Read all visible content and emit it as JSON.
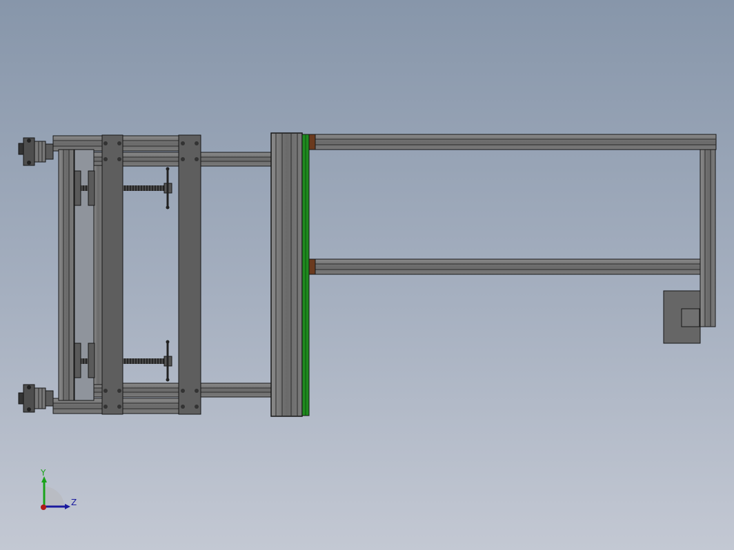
{
  "app": {
    "view_name": "cad-model-viewport"
  },
  "triad": {
    "y_label": "Y",
    "z_label": "Z",
    "colors": {
      "y_axis": "#19a319",
      "z_axis": "#1a1a9e",
      "x_axis": "#b01818"
    }
  },
  "colors": {
    "profile_fill": "#6e6e6e",
    "profile_dark": "#3c3c3c",
    "profile_light": "#9a9a9a",
    "plate": "#5e5e5e",
    "edge": "#161616",
    "green_strip": "#1f8a1f",
    "brown_end_cap": "#6b3a1e",
    "motor_box": "#666666"
  },
  "parts": [
    {
      "name": "left-clamp-frame",
      "label": ""
    },
    {
      "name": "clamp-plate-left",
      "label": ""
    },
    {
      "name": "clamp-plate-right",
      "label": ""
    },
    {
      "name": "lead-screw-upper",
      "label": ""
    },
    {
      "name": "lead-screw-lower",
      "label": ""
    },
    {
      "name": "motor-coupling-upper",
      "label": ""
    },
    {
      "name": "motor-coupling-lower",
      "label": ""
    },
    {
      "name": "vertical-post",
      "label": ""
    },
    {
      "name": "green-guide-rail",
      "label": ""
    },
    {
      "name": "upper-horizontal-beam",
      "label": ""
    },
    {
      "name": "middle-horizontal-beam",
      "label": ""
    },
    {
      "name": "right-vertical-beam",
      "label": ""
    },
    {
      "name": "motor-box",
      "label": ""
    }
  ]
}
